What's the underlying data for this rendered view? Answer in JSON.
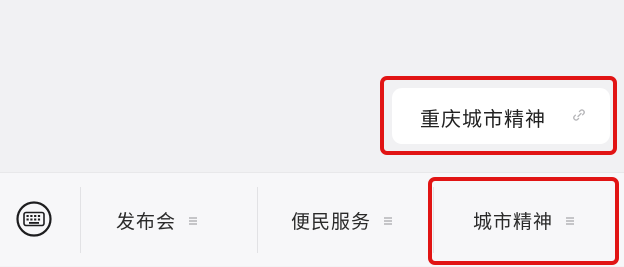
{
  "chat": {
    "message_text": "重庆城市精神",
    "message_icon": "link-icon"
  },
  "menu": {
    "keyboard_icon": "keyboard-icon",
    "items": [
      {
        "label": "发布会",
        "icon": "submenu-icon"
      },
      {
        "label": "便民服务",
        "icon": "submenu-icon"
      },
      {
        "label": "城市精神",
        "icon": "submenu-icon"
      }
    ]
  },
  "colors": {
    "highlight": "#e11414",
    "chat_background": "#f1f1f3",
    "bubble_background": "#ffffff",
    "menu_background": "#f7f7f9"
  }
}
